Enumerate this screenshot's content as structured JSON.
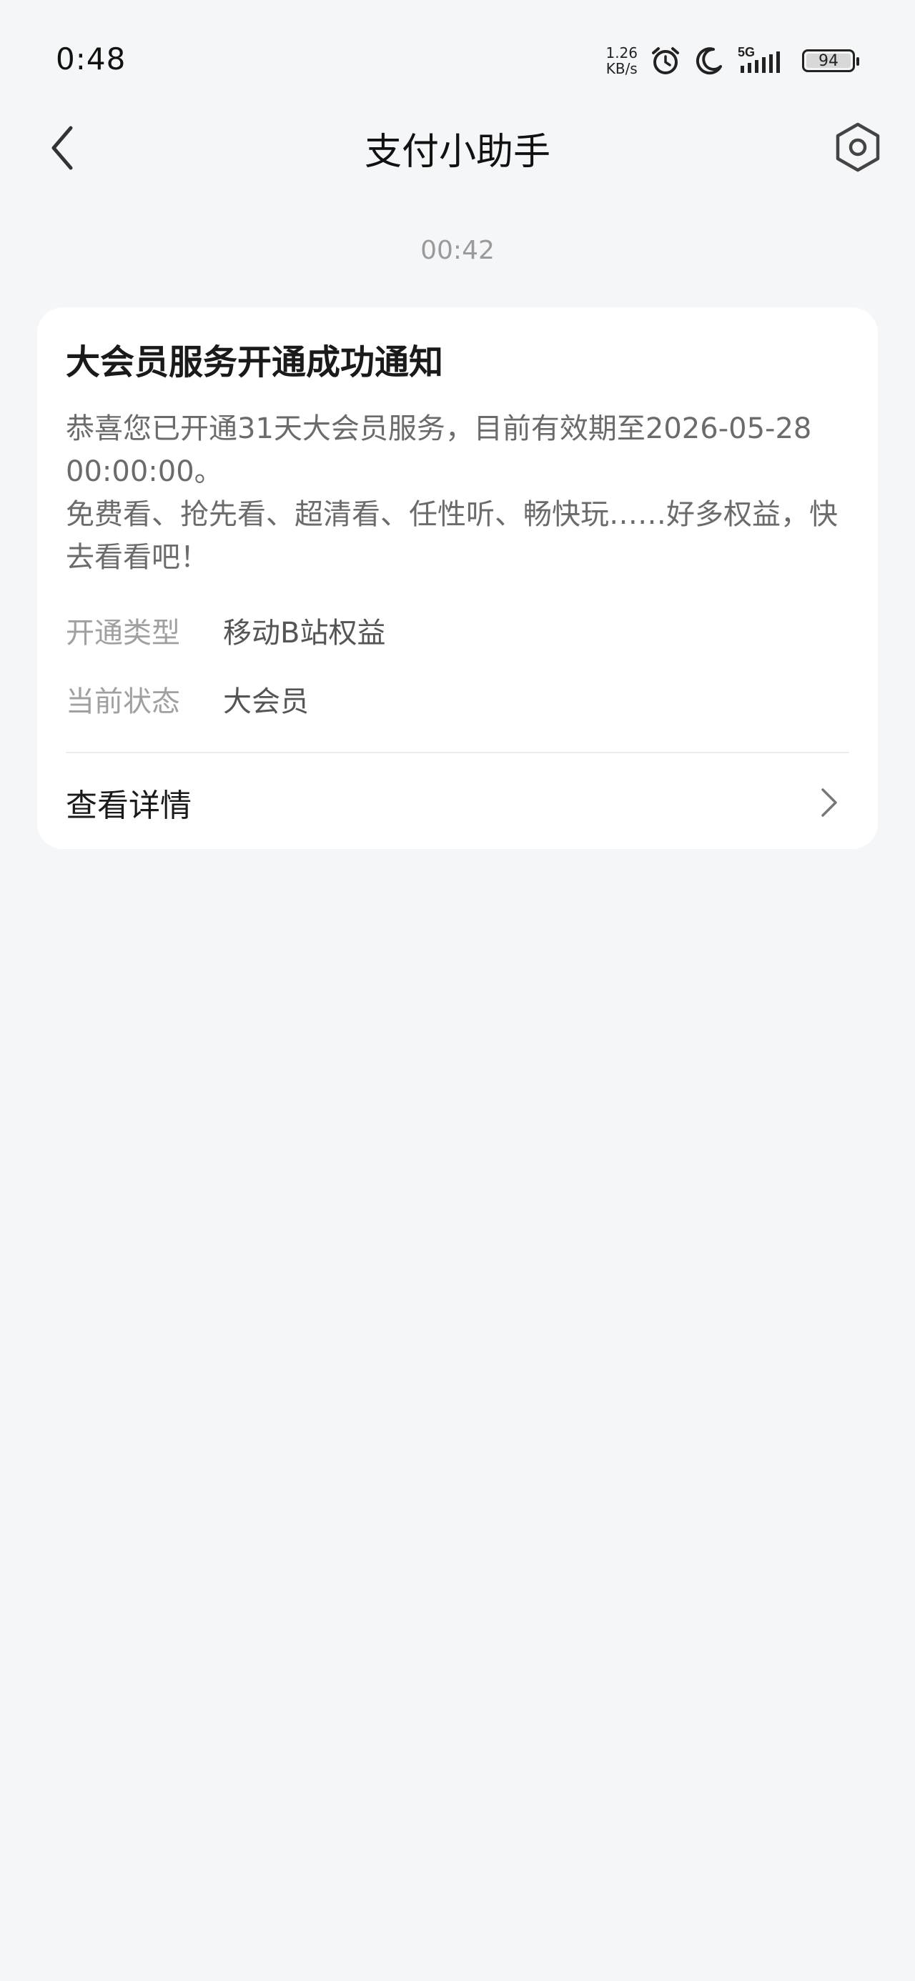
{
  "status_bar": {
    "time": "0:48",
    "net_speed_value": "1.26",
    "net_speed_unit": "KB/s",
    "network_type": "5G",
    "battery_level": "94",
    "icons": [
      "alarm-icon",
      "do-not-disturb-moon-icon",
      "signal-5g-icon",
      "battery-icon"
    ]
  },
  "header": {
    "title": "支付小助手",
    "back_icon": "chevron-left-icon",
    "settings_icon": "settings-hexagon-icon"
  },
  "message": {
    "timestamp": "00:42",
    "card": {
      "title": "大会员服务开通成功通知",
      "body_line_1": "恭喜您已开通31天大会员服务，目前有效期至2026-05-28 00:00:00。",
      "body_line_2": "免费看、抢先看、超清看、任性听、畅快玩……好多权益，快去看看吧！",
      "rows": [
        {
          "label": "开通类型",
          "value": "移动B站权益"
        },
        {
          "label": "当前状态",
          "value": "大会员"
        }
      ],
      "detail_label": "查看详情"
    }
  },
  "colors": {
    "background": "#f5f6f8",
    "card": "#ffffff",
    "title_text": "#1a1a1a",
    "secondary_text": "#6b6b6b",
    "label_text": "#a0a0a0"
  }
}
